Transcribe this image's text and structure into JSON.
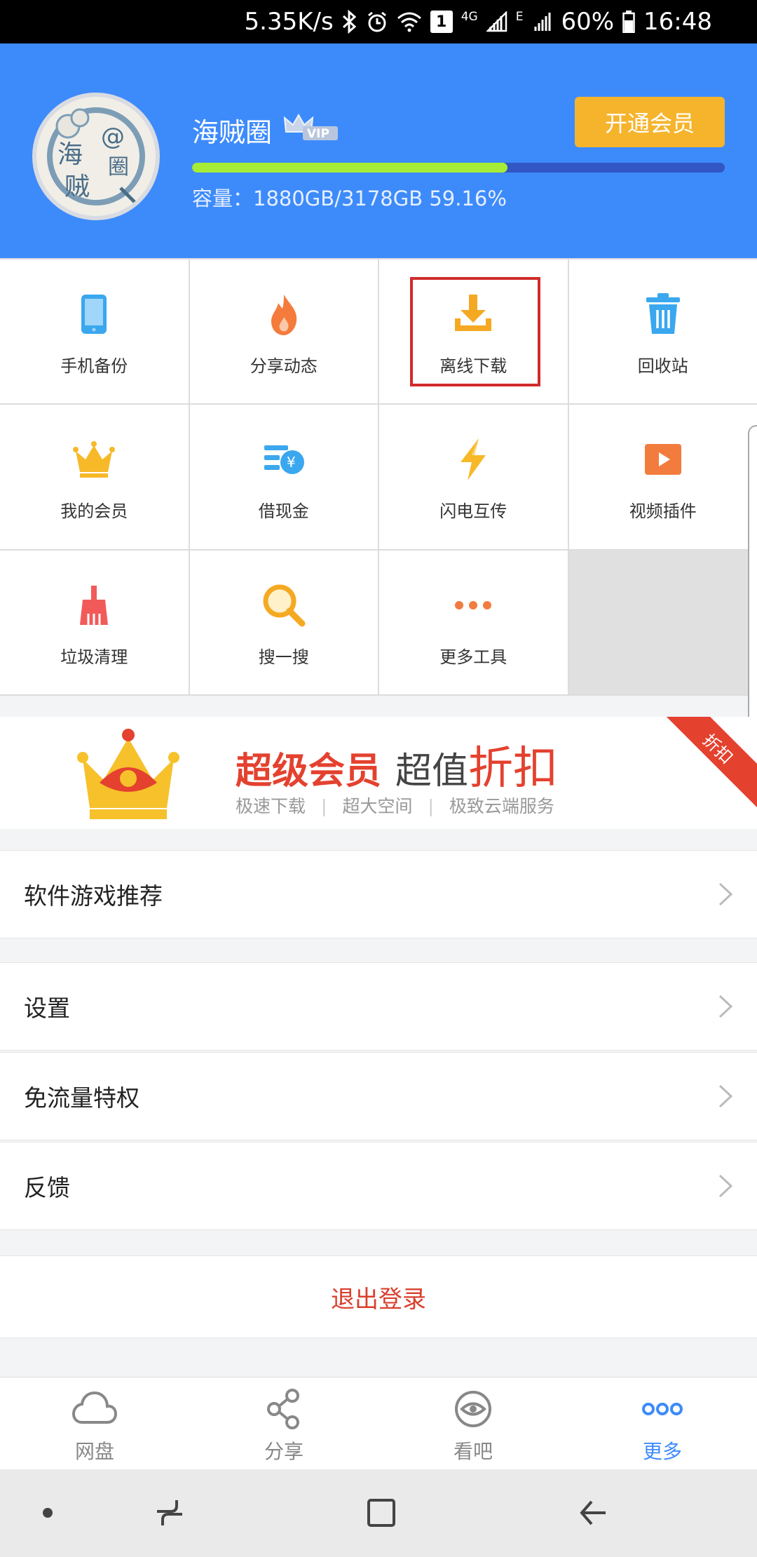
{
  "status_bar": {
    "speed": "5.35K/s",
    "network_4g": "4G",
    "network_e": "E",
    "sim_slot": "1",
    "battery": "60%",
    "time": "16:48"
  },
  "profile": {
    "avatar_text_1": "海",
    "avatar_text_2": "贼",
    "avatar_text_3": "@",
    "avatar_text_4": "圈",
    "username": "海贼圈",
    "vip_label": "VIP",
    "open_vip_button": "开通会员",
    "storage_text": "容量：1880GB/3178GB 59.16%",
    "storage_fraction": 0.5916
  },
  "tools": [
    {
      "label": "手机备份",
      "icon": "phone-icon"
    },
    {
      "label": "分享动态",
      "icon": "flame-icon"
    },
    {
      "label": "离线下载",
      "icon": "download-icon"
    },
    {
      "label": "回收站",
      "icon": "trash-icon"
    },
    {
      "label": "我的会员",
      "icon": "crown-icon"
    },
    {
      "label": "借现金",
      "icon": "cash-icon"
    },
    {
      "label": "闪电互传",
      "icon": "lightning-icon"
    },
    {
      "label": "视频插件",
      "icon": "video-icon"
    },
    {
      "label": "垃圾清理",
      "icon": "broom-icon"
    },
    {
      "label": "搜一搜",
      "icon": "search-icon"
    },
    {
      "label": "更多工具",
      "icon": "more-dots-icon"
    }
  ],
  "banner": {
    "title_red": "超级会员",
    "title_gray": "超值",
    "title_big": "折扣",
    "sub": [
      "极速下载",
      "超大空间",
      "极致云端服务"
    ],
    "sub_sep": "|",
    "ribbon": "折扣"
  },
  "menu": {
    "recommend": "软件游戏推荐",
    "settings": "设置",
    "free_data": "免流量特权",
    "feedback": "反馈"
  },
  "logout": "退出登录",
  "tabs": [
    {
      "label": "网盘",
      "icon": "cloud-icon"
    },
    {
      "label": "分享",
      "icon": "share-icon"
    },
    {
      "label": "看吧",
      "icon": "eye-icon"
    },
    {
      "label": "更多",
      "icon": "more-icon",
      "active": true
    }
  ],
  "colors": {
    "header_blue": "#3d8bfb",
    "vip_button": "#f6b42c",
    "storage_fill": "#a6ec36",
    "highlight_red": "#d12b2b",
    "accent_red": "#e4412f"
  }
}
